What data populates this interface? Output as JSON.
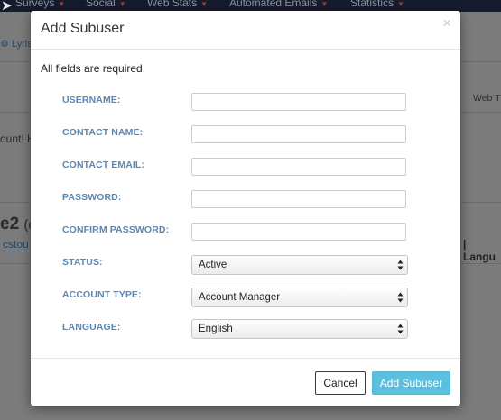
{
  "background": {
    "nav": {
      "items": [
        {
          "label": "Surveys"
        },
        {
          "label": "Social"
        },
        {
          "label": "Web Stats"
        },
        {
          "label": "Automated Emails"
        },
        {
          "label": "Statistics"
        }
      ]
    },
    "breadcrumb_fragment": "Lyris",
    "web_fragment": "Web T",
    "account_fragment": "ount! H",
    "heading_fragment": "e2",
    "heading_suffix_fragment": "(c",
    "user_link_fragment": "cstou",
    "language_fragment": "| Langu"
  },
  "modal": {
    "title": "Add Subuser",
    "close_glyph": "×",
    "note": "All fields are required.",
    "fields": {
      "username": {
        "label": "USERNAME:",
        "value": ""
      },
      "contact_name": {
        "label": "CONTACT NAME:",
        "value": ""
      },
      "contact_email": {
        "label": "CONTACT EMAIL:",
        "value": ""
      },
      "password": {
        "label": "PASSWORD:",
        "value": ""
      },
      "confirm_password": {
        "label": "CONFIRM PASSWORD:",
        "value": ""
      },
      "status": {
        "label": "STATUS:",
        "selected": "Active"
      },
      "account_type": {
        "label": "ACCOUNT TYPE:",
        "selected": "Account Manager"
      },
      "language": {
        "label": "LANGUAGE:",
        "selected": "English"
      }
    },
    "buttons": {
      "cancel": "Cancel",
      "submit": "Add Subuser"
    }
  },
  "colors": {
    "label_blue": "#5b87b6",
    "primary_button": "#5bc0de",
    "nav_background": "#161b2e"
  },
  "icons": {
    "close": "close-icon",
    "select_arrows": "select-arrows-icon",
    "cursor": "mouse-cursor-icon"
  }
}
